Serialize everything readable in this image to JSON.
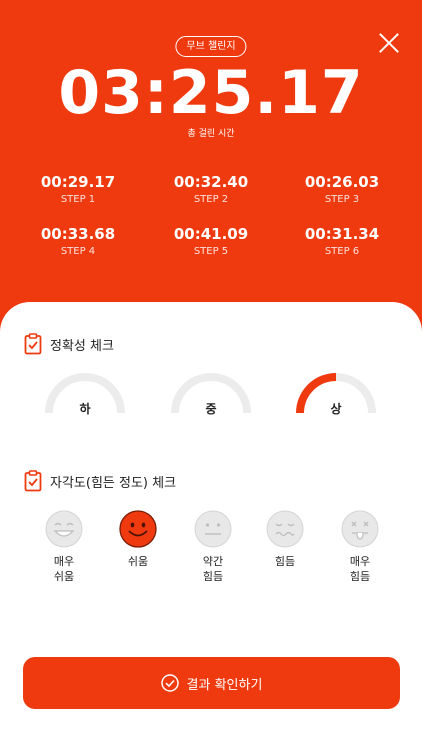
{
  "header": {
    "badge": "무브 챌린지",
    "total_time": "03:25.17",
    "total_label": "총 걸린 시간"
  },
  "steps": [
    {
      "time": "00:29.17",
      "label": "STEP 1"
    },
    {
      "time": "00:32.40",
      "label": "STEP 2"
    },
    {
      "time": "00:26.03",
      "label": "STEP 3"
    },
    {
      "time": "00:33.68",
      "label": "STEP 4"
    },
    {
      "time": "00:41.09",
      "label": "STEP 5"
    },
    {
      "time": "00:31.34",
      "label": "STEP 6"
    }
  ],
  "accuracy": {
    "title": "정확성 체크",
    "options": [
      {
        "label": "하",
        "selected": false
      },
      {
        "label": "중",
        "selected": false
      },
      {
        "label": "상",
        "selected": true
      }
    ]
  },
  "exertion": {
    "title": "자각도(힘든 정도) 체크",
    "options": [
      {
        "label": "매우\n쉬움",
        "icon": "very-easy-face-icon",
        "selected": false
      },
      {
        "label": "쉬움",
        "icon": "easy-face-icon",
        "selected": true
      },
      {
        "label": "약간\n힘듬",
        "icon": "neutral-face-icon",
        "selected": false
      },
      {
        "label": "힘듬",
        "icon": "hard-face-icon",
        "selected": false
      },
      {
        "label": "매우\n힘듬",
        "icon": "very-hard-face-icon",
        "selected": false
      }
    ]
  },
  "confirm_button": {
    "label": "결과 확인하기"
  },
  "colors": {
    "accent": "#ef3a10",
    "track": "#ececec",
    "face_inactive": "#e6e6e6"
  }
}
